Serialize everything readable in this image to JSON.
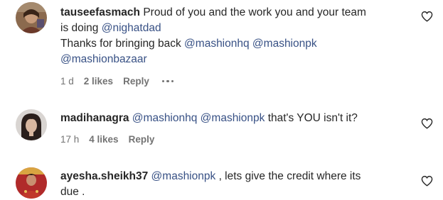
{
  "comments": [
    {
      "username": "tauseefasmach",
      "line1_text": "Proud of you and the work you and your team",
      "line2_text": "is doing ",
      "line2_mention": "@nighatdad",
      "line3_text": "Thanks for bringing back ",
      "line3_mention1": "@mashionhq",
      "line3_mention2": "@mashionpk",
      "line4_mention": "@mashionbazaar",
      "time": "1 d",
      "likes": "2 likes",
      "reply": "Reply",
      "avatar_icon": "avatar-icon",
      "like_icon": "heart-icon",
      "more_icon": "more-options-icon"
    },
    {
      "username": "madihanagra",
      "mention1": "@mashionhq",
      "mention2": "@mashionpk",
      "text": "that's YOU isn't it?",
      "time": "17 h",
      "likes": "4 likes",
      "reply": "Reply",
      "avatar_icon": "avatar-icon",
      "like_icon": "heart-icon"
    },
    {
      "username": "ayesha.sheikh37",
      "mention1": "@mashionpk",
      "line1_text": ", lets give the credit where its",
      "line2_text": "due .",
      "avatar_icon": "avatar-icon",
      "like_icon": "heart-icon"
    }
  ],
  "colors": {
    "text": "#262626",
    "mention": "#385185",
    "meta": "#737373"
  }
}
